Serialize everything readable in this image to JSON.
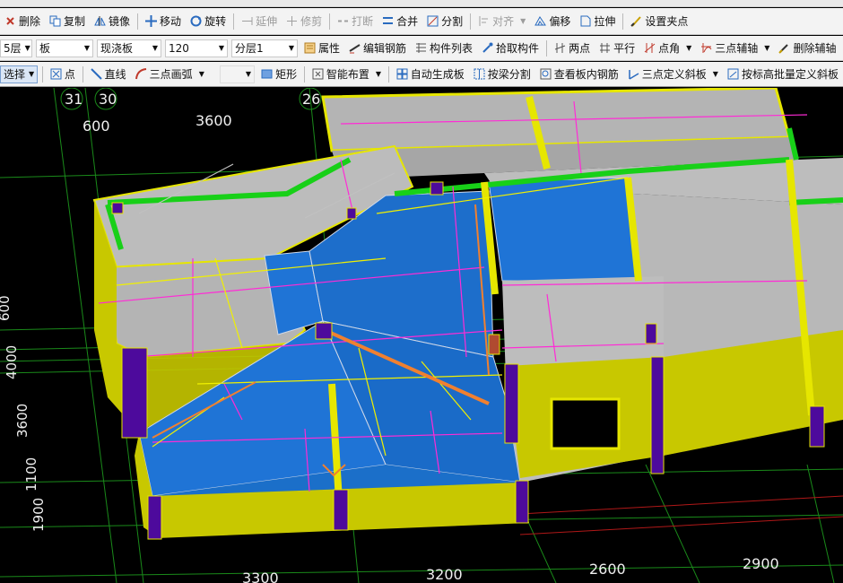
{
  "toolbar_row1": {
    "delete": "删除",
    "copy": "复制",
    "mirror": "镜像",
    "move": "移动",
    "rotate": "旋转",
    "extend": "延伸",
    "trim": "修剪",
    "break": "打断",
    "merge": "合并",
    "split": "分割",
    "align": "对齐",
    "offset": "偏移",
    "stretch": "拉伸",
    "set_grip": "设置夹点"
  },
  "toolbar_row2": {
    "floor": "5层",
    "component_type": "板",
    "subtype": "现浇板",
    "thickness": "120",
    "layer": "分层1",
    "properties": "属性",
    "edit_rebar": "编辑钢筋",
    "component_list": "构件列表",
    "pick_component": "拾取构件",
    "two_points": "两点",
    "parallel": "平行",
    "point_angle": "点角",
    "three_point_axis": "三点辅轴",
    "delete_axis": "删除辅轴"
  },
  "toolbar_row3": {
    "select": "选择",
    "point": "点",
    "line": "直线",
    "arc": "三点画弧",
    "rect": "矩形",
    "smart_layout": "智能布置",
    "auto_generate_slab": "自动生成板",
    "split_by_beam": "按梁分割",
    "view_slab_rebar": "查看板内钢筋",
    "three_point_slope": "三点定义斜板",
    "batch_slope": "按标高批量定义斜板"
  },
  "viewport": {
    "axis_labels": [
      "31",
      "30",
      "26"
    ],
    "top_dims": [
      "600",
      "3600"
    ],
    "left_dims": [
      "600",
      "4000",
      "3600",
      "1100",
      "1900"
    ],
    "bottom_dims": [
      "3300",
      "3200",
      "2600",
      "2900"
    ]
  },
  "colors": {
    "toolbar_bg": "#f3f3f3",
    "canvas_bg": "#000000",
    "slab_gray": "#b7b7b7",
    "slope_blue": "#1f74d6",
    "wall_yellow": "#c8c800",
    "column_purple": "#4d0a9c",
    "beam_green": "#18d018",
    "rebar_magenta": "#ff2bd6",
    "grid_green": "#1a8a1a"
  }
}
